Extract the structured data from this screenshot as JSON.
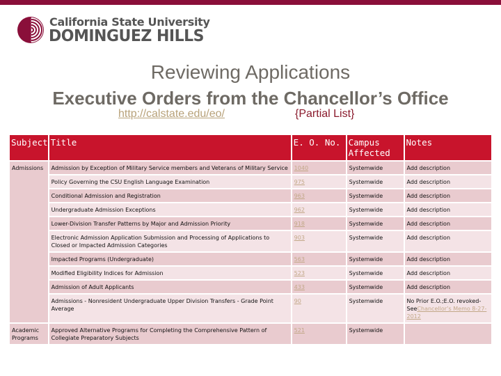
{
  "logo": {
    "line1": "California State University",
    "line2": "DOMINGUEZ HILLS",
    "icon": "csudh-seal-icon"
  },
  "colors": {
    "brand": "#8a0f3a",
    "header_red": "#c8142c",
    "row_dark": "#e9cbcf",
    "row_light": "#f4e3e6",
    "link": "#c2a888"
  },
  "title": "Reviewing Applications",
  "subtitle": "Executive Orders from the Chancellor’s Office",
  "link_text": "http://calstate.edu/eo/",
  "partial_label": "{Partial List}",
  "table": {
    "headers": [
      "Subject",
      "Title",
      "E. O. No.",
      "Campus Affected",
      "Notes"
    ],
    "rows": [
      {
        "subject": "Admissions",
        "title": "Admission by Exception of Military Service members and Veterans of Military Service",
        "eo": "1040",
        "campus": "Systemwide",
        "notes": "Add description"
      },
      {
        "subject": "",
        "title": "Policy Governing the CSU English Language Examination",
        "eo": "975",
        "campus": "Systemwide",
        "notes": "Add description"
      },
      {
        "subject": "",
        "title": "Conditional Admission and Registration",
        "eo": "963",
        "campus": "Systemwide",
        "notes": "Add description"
      },
      {
        "subject": "",
        "title": "Undergraduate Admission Exceptions",
        "eo": "962",
        "campus": "Systemwide",
        "notes": "Add description"
      },
      {
        "subject": "",
        "title": "Lower-Division Transfer Patterns by Major and Admission Priority",
        "eo": "918",
        "campus": "Systemwide",
        "notes": "Add description"
      },
      {
        "subject": "",
        "title": "Electronic Admission Application Submission and Processing of Applications to Closed or Impacted Admission Categories",
        "eo": "903",
        "campus": "Systemwide",
        "notes": "Add description"
      },
      {
        "subject": "",
        "title": "Impacted Programs (Undergraduate)",
        "eo": "563",
        "campus": "Systemwide",
        "notes": "Add description"
      },
      {
        "subject": "",
        "title": "Modified Eligibility Indices for Admission",
        "eo": "523",
        "campus": "Systemwide",
        "notes": "Add description"
      },
      {
        "subject": "",
        "title": "Admission of Adult Applicants",
        "eo": "433",
        "campus": "Systemwide",
        "notes": "Add description"
      },
      {
        "subject": "",
        "title": "Admissions - Nonresident Undergraduate Upper Division Transfers - Grade Point Average",
        "eo": "90",
        "campus": "Systemwide",
        "notes_prefix": "No Prior E.O.;E.O. revoked- See",
        "notes_link": "Chancellor’s Memo 8-27-2012"
      },
      {
        "subject": "Academic Programs",
        "title": "Approved Alternative Programs for Completing the Comprehensive Pattern of Collegiate Preparatory Subjects",
        "eo": "521",
        "campus": "Systemwide",
        "notes": ""
      }
    ]
  }
}
